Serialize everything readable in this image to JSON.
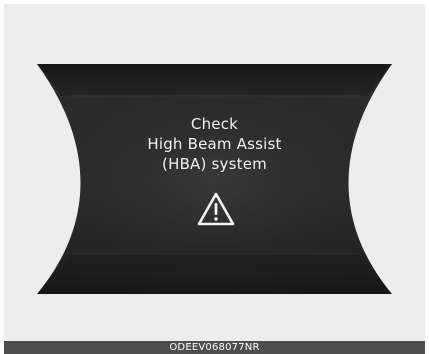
{
  "display": {
    "lines": [
      "Check",
      "High Beam Assist",
      "(HBA) system"
    ],
    "icon": "warning-triangle-icon",
    "colors": {
      "frame_background": "#ededed",
      "display_background": "#1f1f1f",
      "text": "#f2f2f2",
      "caption_bar": "#4d4d4d"
    }
  },
  "caption": {
    "code": "ODEEV068077NR"
  }
}
